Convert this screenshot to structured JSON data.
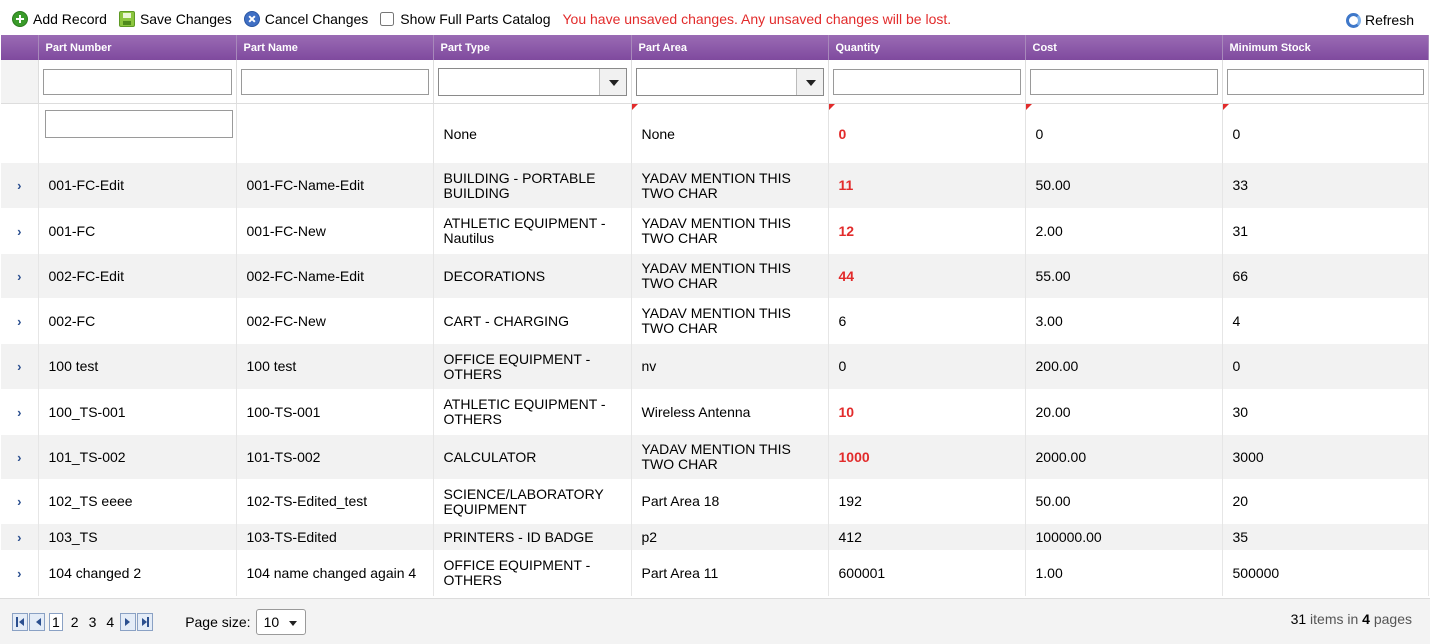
{
  "toolbar": {
    "add_label": "Add Record",
    "save_label": "Save Changes",
    "cancel_label": "Cancel Changes",
    "show_catalog_label": "Show Full Parts Catalog",
    "show_catalog_checked": false,
    "warning": "You have unsaved changes. Any unsaved changes will be lost.",
    "refresh_label": "Refresh"
  },
  "columns": [
    "Part Number",
    "Part Name",
    "Part Type",
    "Part Area",
    "Quantity",
    "Cost",
    "Minimum Stock"
  ],
  "new_row": {
    "part_type": "None",
    "part_area": "None",
    "quantity": "0",
    "cost": "0",
    "minimum_stock": "0"
  },
  "rows": [
    {
      "part_number": "001-FC-Edit",
      "part_name": "001-FC-Name-Edit",
      "part_type": "BUILDING - PORTABLE BUILDING",
      "part_area": "YADAV MENTION THIS TWO CHAR",
      "quantity": "11",
      "quantity_low": true,
      "cost": "50.00",
      "minimum_stock": "33"
    },
    {
      "part_number": "001-FC",
      "part_name": "001-FC-New",
      "part_type": "ATHLETIC EQUIPMENT - Nautilus",
      "part_area": "YADAV MENTION THIS TWO CHAR",
      "quantity": "12",
      "quantity_low": true,
      "cost": "2.00",
      "minimum_stock": "31"
    },
    {
      "part_number": "002-FC-Edit",
      "part_name": "002-FC-Name-Edit",
      "part_type": "DECORATIONS",
      "part_area": "YADAV MENTION THIS TWO CHAR",
      "quantity": "44",
      "quantity_low": true,
      "cost": "55.00",
      "minimum_stock": "66"
    },
    {
      "part_number": "002-FC",
      "part_name": "002-FC-New",
      "part_type": "CART - CHARGING",
      "part_area": "YADAV MENTION THIS TWO CHAR",
      "quantity": "6",
      "quantity_low": false,
      "cost": "3.00",
      "minimum_stock": "4"
    },
    {
      "part_number": "100 test",
      "part_name": "100 test",
      "part_type": "OFFICE EQUIPMENT - OTHERS",
      "part_area": "nv",
      "quantity": "0",
      "quantity_low": false,
      "cost": "200.00",
      "minimum_stock": "0"
    },
    {
      "part_number": "100_TS-001",
      "part_name": "100-TS-001",
      "part_type": "ATHLETIC EQUIPMENT - OTHERS",
      "part_area": "Wireless Antenna",
      "quantity": "10",
      "quantity_low": true,
      "cost": "20.00",
      "minimum_stock": "30"
    },
    {
      "part_number": "101_TS-002",
      "part_name": "101-TS-002",
      "part_type": "CALCULATOR",
      "part_area": "YADAV MENTION THIS TWO CHAR",
      "quantity": "1000",
      "quantity_low": true,
      "cost": "2000.00",
      "minimum_stock": "3000"
    },
    {
      "part_number": "102_TS eeee",
      "part_name": "102-TS-Edited_test",
      "part_type": "SCIENCE/LABORATORY EQUIPMENT",
      "part_area": "Part Area 18",
      "quantity": "192",
      "quantity_low": false,
      "cost": "50.00",
      "minimum_stock": "20"
    },
    {
      "part_number": "103_TS",
      "part_name": "103-TS-Edited",
      "part_type": "PRINTERS - ID BADGE",
      "part_area": "p2",
      "quantity": "412",
      "quantity_low": false,
      "cost": "100000.00",
      "minimum_stock": "35"
    },
    {
      "part_number": "104 changed 2",
      "part_name": "104 name changed again 4",
      "part_type": "OFFICE EQUIPMENT - OTHERS",
      "part_area": "Part Area 11",
      "quantity": "600001",
      "quantity_low": false,
      "cost": "1.00",
      "minimum_stock": "500000"
    }
  ],
  "pager": {
    "pages": [
      "1",
      "2",
      "3",
      "4"
    ],
    "current_page": "1",
    "page_size_label": "Page size:",
    "page_size": "10",
    "total_items": "31",
    "items_in_text": "items in",
    "total_pages": "4",
    "pages_text": "pages"
  },
  "colors": {
    "header": "#8a55a8",
    "warning": "#e22b2b",
    "alt_row": "#f2f2f2"
  }
}
